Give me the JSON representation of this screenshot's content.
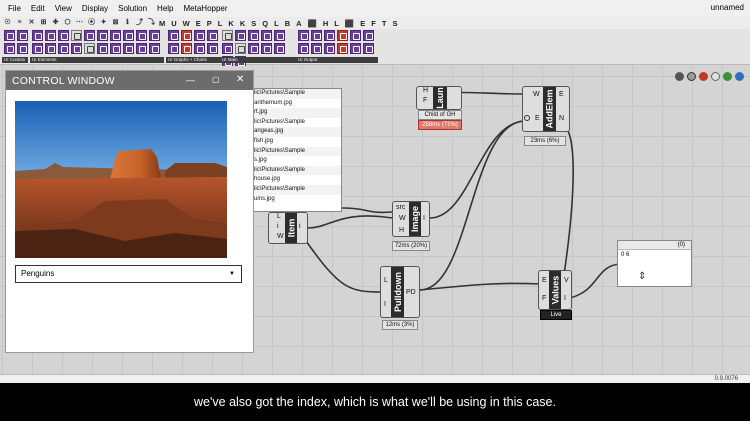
{
  "menubar": {
    "items": [
      "File",
      "Edit",
      "View",
      "Display",
      "Solution",
      "Help",
      "MetaHopper"
    ],
    "document_title": "unnamed"
  },
  "tabrow": {
    "glyphs": [
      "☉",
      "≡",
      "✕",
      "⊞",
      "✚",
      "⬡",
      "⋯",
      "⦿",
      "✦",
      "⊠",
      "ℹ",
      "⤴",
      "⤵"
    ],
    "tabs": [
      "M",
      "U",
      "W",
      "E",
      "P",
      "L",
      "K",
      "K",
      "S",
      "Q",
      "L",
      "B",
      "A",
      "⬛",
      "H",
      "L",
      "⬛",
      "E",
      "F",
      "T",
      "S"
    ]
  },
  "ribbon": {
    "groups": [
      "UI Contain",
      "UI Elements",
      "UI Graphs + Charts",
      "UI Main",
      "UI Output"
    ]
  },
  "control_window": {
    "title": "CONTROL WINDOW",
    "dropdown_value": "Penguins"
  },
  "file_list": {
    "rows": [
      "lic\\Pictures\\Sample",
      "anthemum.jpg",
      "rt.jpg",
      "lic\\Pictures\\Sample",
      "angeas.jpg",
      "fish.jpg",
      "lic\\Pictures\\Sample",
      "s.jpg",
      "lic\\Pictures\\Sample",
      "house.jpg",
      "lic\\Pictures\\Sample",
      "uins.jpg"
    ]
  },
  "components": {
    "launch": {
      "name": "Laun",
      "ports_in": [
        "H",
        "F"
      ],
      "sub_label": "Child of GH",
      "timing": "258ms (71%)"
    },
    "add_element": {
      "name": "AddElem",
      "ports_in": [
        "W",
        "E"
      ],
      "ports_out": [
        "E",
        "N"
      ],
      "timing": "23ms (6%)"
    },
    "image": {
      "name": "Image",
      "ports_in": [
        "src",
        "W",
        "H"
      ],
      "ports_out": [
        "I"
      ],
      "timing": "72ms (20%)"
    },
    "item": {
      "name": "Item",
      "ports_in": [
        "L",
        "i",
        "W"
      ],
      "ports_out": [
        "i"
      ]
    },
    "pulldown": {
      "name": "Pulldown",
      "ports_in": [
        "L",
        "I"
      ],
      "ports_out": [
        "PD"
      ],
      "timing": "12ms (3%)"
    },
    "values": {
      "name": "Values",
      "ports_in": [
        "E",
        "F"
      ],
      "ports_out": [
        "V",
        "I"
      ],
      "timing": "Live"
    },
    "panel": {
      "header": "(0)",
      "line": "0  6"
    }
  },
  "statusbar": {
    "version": "0.9.0076"
  },
  "caption": "we've also got the index, which is what we'll be using in this case."
}
